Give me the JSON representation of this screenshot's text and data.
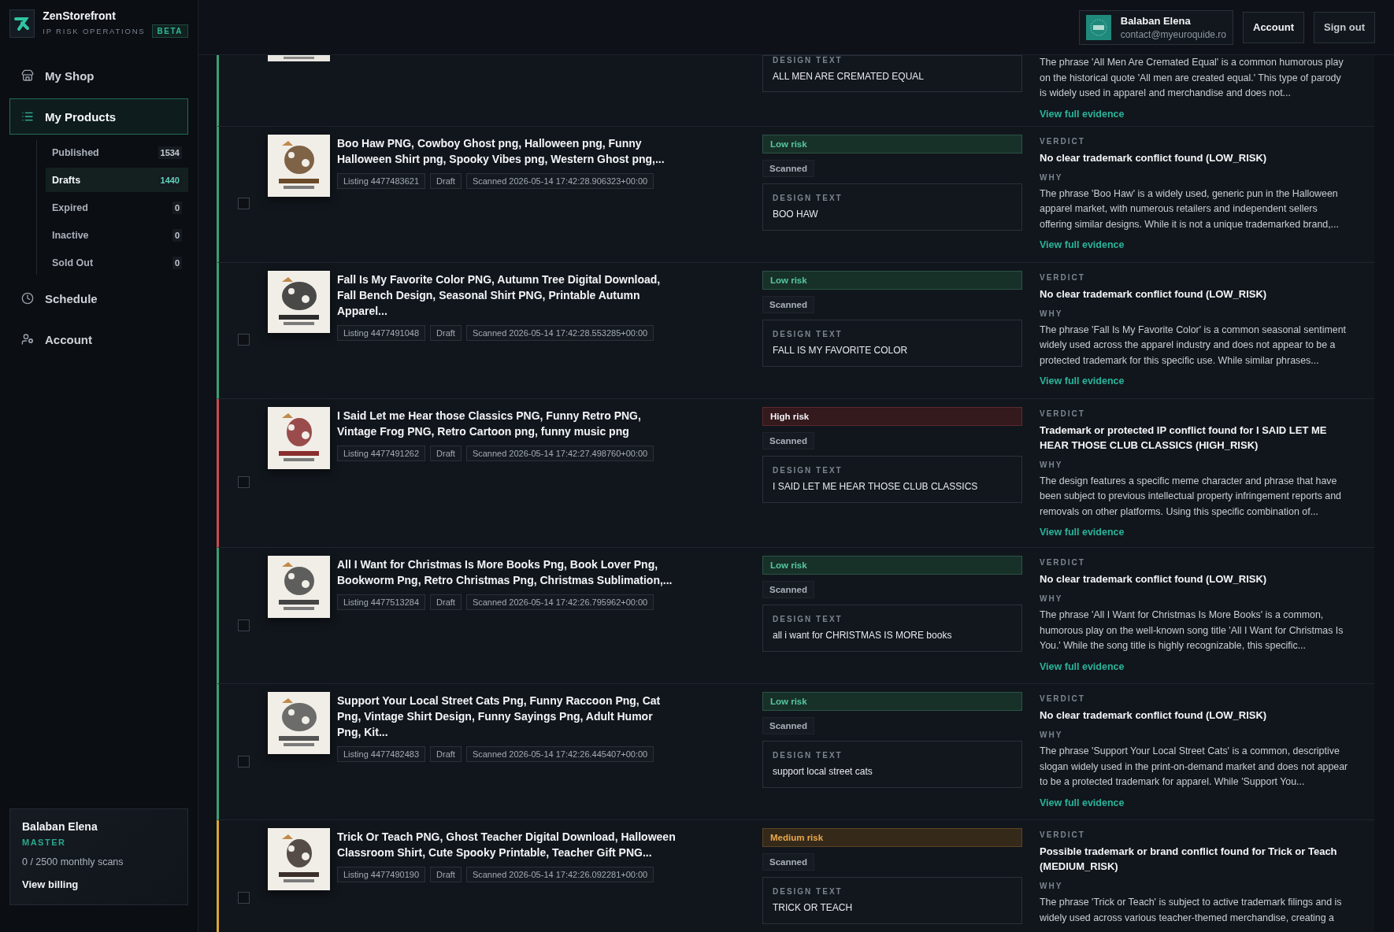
{
  "brand": {
    "name": "ZenStorefront",
    "tagline": "IP RISK OPERATIONS",
    "badge": "BETA"
  },
  "sidebar": {
    "items": [
      {
        "label": "My Shop",
        "kind": "store",
        "selected": false
      },
      {
        "label": "My Products",
        "kind": "list",
        "selected": true,
        "children": [
          {
            "label": "Published",
            "count": "1534",
            "selected": false
          },
          {
            "label": "Drafts",
            "count": "1440",
            "selected": true
          },
          {
            "label": "Expired",
            "count": "0",
            "selected": false
          },
          {
            "label": "Inactive",
            "count": "0",
            "selected": false
          },
          {
            "label": "Sold Out",
            "count": "0",
            "selected": false
          }
        ]
      },
      {
        "label": "Schedule",
        "kind": "clock",
        "selected": false
      },
      {
        "label": "Account",
        "kind": "users",
        "selected": false
      }
    ],
    "plan_card": {
      "name": "Balaban Elena",
      "plan": "MASTER",
      "usage": "0 / 2500 monthly scans",
      "link": "View billing"
    }
  },
  "header": {
    "user": {
      "name": "Balaban Elena",
      "email": "contact@myeuroquide.ro"
    },
    "buttons": [
      "Account",
      "Sign out"
    ]
  },
  "rows": [
    {
      "kind": "low",
      "design_text_label": "DESIGN TEXT",
      "design_text": "ALL MEN ARE CREMATED EQUAL",
      "why": "The phrase 'All Men Are Cremated Equal' is a common humorous play on the historical quote 'All men are created equal.' This type of parody is widely used in apparel and merchandise and does not...",
      "link": "View full evidence"
    },
    {
      "kind": "low",
      "risk_label": "Low risk",
      "checked": false,
      "title": "Boo Haw PNG, Cowboy Ghost png, Halloween png, Funny Halloween Shirt png, Spooky Vibes png, Western Ghost png,...",
      "listing": "Listing 4477483621",
      "status": "Draft",
      "scanned": "Scanned 2026-05-14 17:42:28.906323+00:00",
      "scan_badge": "Scanned",
      "design_text_label": "DESIGN TEXT",
      "design_text": "BOO HAW",
      "verdict_label": "VERDICT",
      "verdict": "No clear trademark conflict found (LOW_RISK)",
      "why_label": "WHY",
      "why": "The phrase 'Boo Haw' is a widely used, generic pun in the Halloween apparel market, with numerous retailers and independent sellers offering similar designs. While it is not a unique trademarked brand,...",
      "link": "View full evidence"
    },
    {
      "kind": "low",
      "risk_label": "Low risk",
      "checked": false,
      "title": "Fall Is My Favorite Color PNG, Autumn Tree Digital Download, Fall Bench Design, Seasonal Shirt PNG, Printable Autumn Apparel...",
      "listing": "Listing 4477491048",
      "status": "Draft",
      "scanned": "Scanned 2026-05-14 17:42:28.553285+00:00",
      "scan_badge": "Scanned",
      "design_text_label": "DESIGN TEXT",
      "design_text": "FALL IS MY FAVORITE COLOR",
      "verdict_label": "VERDICT",
      "verdict": "No clear trademark conflict found (LOW_RISK)",
      "why_label": "WHY",
      "why": "The phrase 'Fall Is My Favorite Color' is a common seasonal sentiment widely used across the apparel industry and does not appear to be a protected trademark for this specific use. While similar phrases...",
      "link": "View full evidence"
    },
    {
      "kind": "high",
      "risk_label": "High risk",
      "checked": false,
      "title": "I Said Let me Hear those Classics PNG, Funny Retro PNG, Vintage Frog PNG, Retro Cartoon png, funny music png",
      "listing": "Listing 4477491262",
      "status": "Draft",
      "scanned": "Scanned 2026-05-14 17:42:27.498760+00:00",
      "scan_badge": "Scanned",
      "design_text_label": "DESIGN TEXT",
      "design_text": "I SAID LET ME HEAR THOSE CLUB CLASSICS",
      "verdict_label": "VERDICT",
      "verdict": "Trademark or protected IP conflict found for I SAID LET ME HEAR THOSE CLUB CLASSICS (HIGH_RISK)",
      "why_label": "WHY",
      "why": "The design features a specific meme character and phrase that have been subject to previous intellectual property infringement reports and removals on other platforms. Using this specific combination of...",
      "link": "View full evidence"
    },
    {
      "kind": "low",
      "risk_label": "Low risk",
      "checked": false,
      "title": "All I Want for Christmas Is More Books Png, Book Lover Png, Bookworm Png, Retro Christmas Png, Christmas Sublimation,...",
      "listing": "Listing 4477513284",
      "status": "Draft",
      "scanned": "Scanned 2026-05-14 17:42:26.795962+00:00",
      "scan_badge": "Scanned",
      "design_text_label": "DESIGN TEXT",
      "design_text": "all i want for CHRISTMAS IS MORE books",
      "verdict_label": "VERDICT",
      "verdict": "No clear trademark conflict found (LOW_RISK)",
      "why_label": "WHY",
      "why": "The phrase 'All I Want for Christmas Is More Books' is a common, humorous play on the well-known song title 'All I Want for Christmas Is You.' While the song title is highly recognizable, this specific...",
      "link": "View full evidence"
    },
    {
      "kind": "low",
      "risk_label": "Low risk",
      "checked": false,
      "title": "Support Your Local Street Cats Png, Funny Raccoon Png, Cat Png, Vintage Shirt Design, Funny Sayings Png, Adult Humor Png, Kit...",
      "listing": "Listing 4477482483",
      "status": "Draft",
      "scanned": "Scanned 2026-05-14 17:42:26.445407+00:00",
      "scan_badge": "Scanned",
      "design_text_label": "DESIGN TEXT",
      "design_text": "support local street cats",
      "verdict_label": "VERDICT",
      "verdict": "No clear trademark conflict found (LOW_RISK)",
      "why_label": "WHY",
      "why": "The phrase 'Support Your Local Street Cats' is a common, descriptive slogan widely used in the print-on-demand market and does not appear to be a protected trademark for apparel. While 'Support You...",
      "link": "View full evidence"
    },
    {
      "kind": "medium",
      "risk_label": "Medium risk",
      "checked": false,
      "title": "Trick Or Teach PNG, Ghost Teacher Digital Download, Halloween Classroom Shirt, Cute Spooky Printable, Teacher Gift PNG...",
      "listing": "Listing 4477490190",
      "status": "Draft",
      "scanned": "Scanned 2026-05-14 17:42:26.092281+00:00",
      "scan_badge": "Scanned",
      "design_text_label": "DESIGN TEXT",
      "design_text": "TRICK OR TEACH",
      "verdict_label": "VERDICT",
      "verdict": "Possible trademark or brand conflict found for Trick or Teach (MEDIUM_RISK)",
      "why_label": "WHY",
      "why": "The phrase 'Trick or Teach' is subject to active trademark filings and is widely used across various teacher-themed merchandise, creating a"
    }
  ]
}
